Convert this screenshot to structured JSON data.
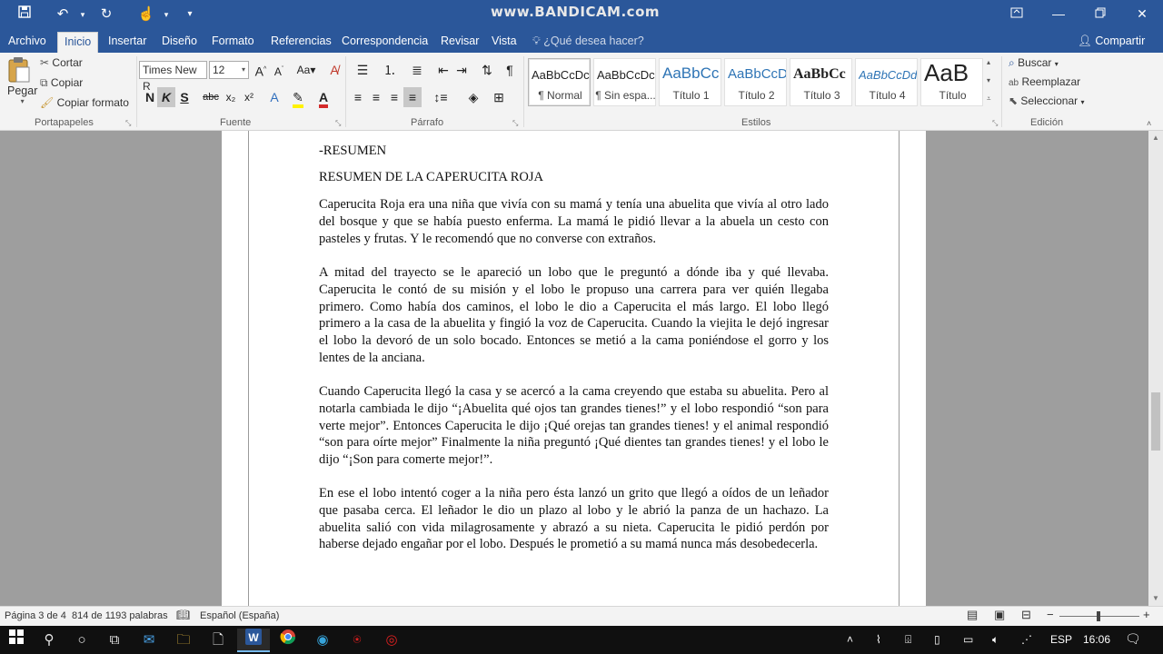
{
  "watermark": "www.BANDICAM.com",
  "tabs": [
    "Archivo",
    "Inicio",
    "Insertar",
    "Diseño",
    "Formato",
    "Referencias",
    "Correspondencia",
    "Revisar",
    "Vista"
  ],
  "active_tab": "Inicio",
  "tell_me": "¿Qué desea hacer?",
  "share": "Compartir",
  "clipboard": {
    "paste": "Pegar",
    "cut": "Cortar",
    "copy": "Copiar",
    "format_painter": "Copiar formato",
    "label": "Portapapeles"
  },
  "font": {
    "name": "Times New R",
    "size": "12",
    "bold": "N",
    "italic": "K",
    "underline": "S",
    "strike": "abc",
    "sub": "x₂",
    "sup": "x²",
    "label": "Fuente"
  },
  "paragraph": {
    "label": "Párrafo"
  },
  "styles": {
    "label": "Estilos",
    "items": [
      {
        "sample": "AaBbCcDc",
        "name": "¶ Normal",
        "color": "#222222"
      },
      {
        "sample": "AaBbCcDc",
        "name": "¶ Sin espa...",
        "color": "#222222"
      },
      {
        "sample": "AaBbCc",
        "name": "Título 1",
        "color": "#2e74b5"
      },
      {
        "sample": "AaBbCcD",
        "name": "Título 2",
        "color": "#2e74b5"
      },
      {
        "sample": "AaBbCc",
        "name": "Título 3",
        "color": "#1f1f1f"
      },
      {
        "sample": "AaBbCcDd",
        "name": "Título 4",
        "color": "#2e74b5"
      },
      {
        "sample": "AaB",
        "name": "Título",
        "color": "#222222"
      }
    ]
  },
  "editing": {
    "find": "Buscar",
    "replace": "Reemplazar",
    "select": "Seleccionar",
    "label": "Edición"
  },
  "document": {
    "heading1": "-RESUMEN",
    "heading2": "RESUMEN DE LA CAPERUCITA ROJA",
    "para1": "Caperucita Roja era una niña que vivía con su mamá y tenía una abuelita que vivía al otro lado del bosque y que se había puesto enferma. La mamá le pidió llevar a la abuela un cesto con pasteles y frutas. Y le recomendó que no converse con extraños.",
    "para2": "A mitad del trayecto se le apareció un lobo que le preguntó a dónde iba y qué llevaba. Caperucita le contó de su misión y el lobo le propuso una carrera para ver quién llegaba primero. Como había dos caminos, el lobo le dio a Caperucita el más largo. El lobo llegó primero a la casa de la abuelita y fingió la voz de Caperucita. Cuando la viejita le dejó ingresar el lobo la devoró de un solo bocado. Entonces se metió a la cama poniéndose el gorro y los lentes de la anciana.",
    "para3": "Cuando Caperucita llegó la casa y se acercó a la cama creyendo que estaba su abuelita. Pero al notarla cambiada le dijo “¡Abuelita qué ojos tan grandes tienes!” y el lobo respondió “son para verte mejor”. Entonces Caperucita le dijo ¡Qué orejas tan grandes tienes! y el animal respondió “son para oírte mejor” Finalmente la niña preguntó ¡Qué dientes tan grandes tienes! y el lobo le dijo “¡Son para comerte mejor!”.",
    "para4": "En ese el lobo intentó coger a la niña pero ésta lanzó un grito que llegó a oídos de un leñador que pasaba cerca. El leñador le dio un plazo al lobo y le abrió la panza de un hachazo. La abuelita salió con vida milagrosamente y abrazó a su nieta. Caperucita le pidió perdón por haberse dejado engañar por el lobo. Después le prometió a su mamá nunca más desobedecerla."
  },
  "status": {
    "page": "Página 3 de 4",
    "words": "814 de 1193 palabras",
    "language": "Español (España)"
  },
  "taskbar": {
    "lang": "ESP",
    "time": "16:06"
  }
}
